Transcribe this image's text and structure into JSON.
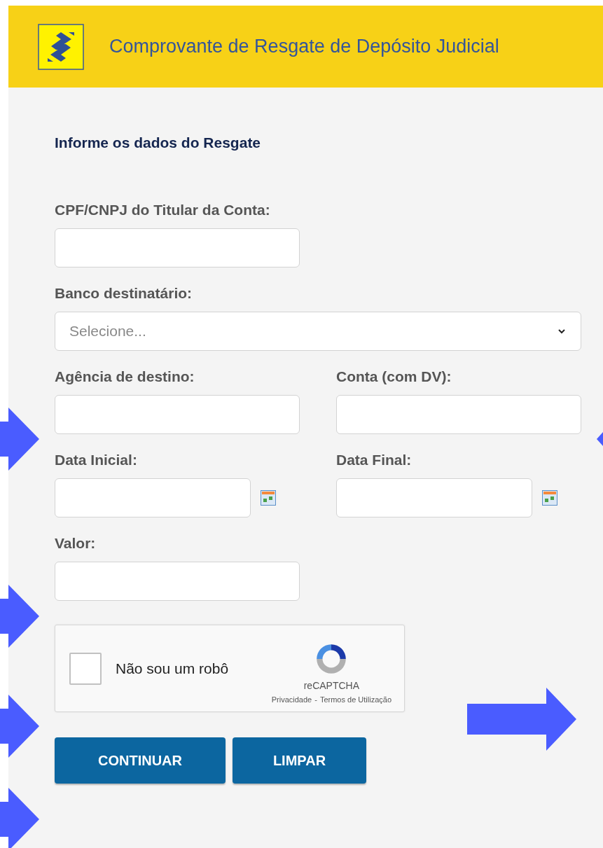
{
  "header": {
    "title": "Comprovante de Resgate de Depósito Judicial"
  },
  "form": {
    "heading": "Informe os dados do Resgate",
    "rows": [
      [
        {
          "label": "CPF/CNPJ do Titular da Conta:",
          "kind": "text"
        }
      ],
      [
        {
          "label": "Banco destinatário:",
          "kind": "select",
          "placeholder": "Selecione..."
        }
      ],
      [
        {
          "label": "Agência de destino:",
          "kind": "text"
        },
        {
          "label": "Conta (com DV):",
          "kind": "text"
        }
      ],
      [
        {
          "label": "Data Inicial:",
          "kind": "date"
        },
        {
          "label": "Data Final:",
          "kind": "date"
        }
      ],
      [
        {
          "label": "Valor:",
          "kind": "text"
        }
      ]
    ]
  },
  "captcha": {
    "checked": false,
    "label": "Não sou um robô",
    "brand": "reCAPTCHA",
    "privacy": "Privacidade",
    "separator": "-",
    "terms": "Termos de Utilização"
  },
  "buttons": [
    "CONTINUAR",
    "LIMPAR"
  ]
}
